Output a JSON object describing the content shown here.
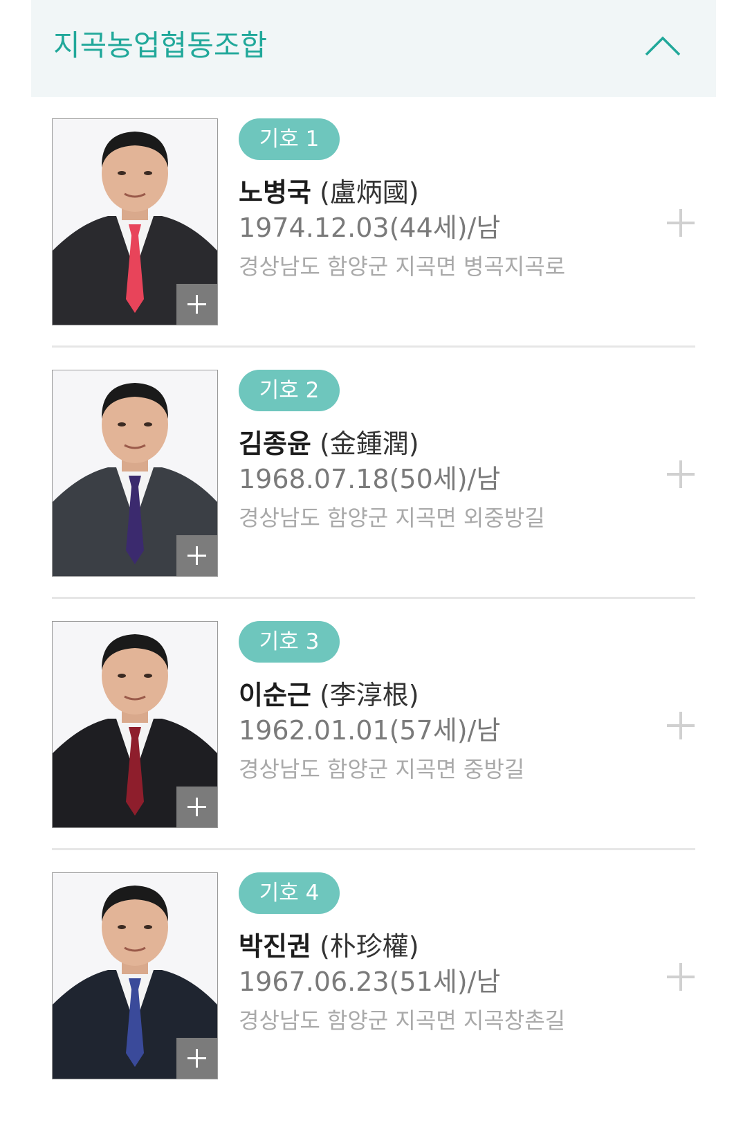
{
  "section": {
    "title": "지곡농업협동조합",
    "collapse_icon": "chevron-up-icon",
    "accent_color": "#21a89a"
  },
  "candidates": [
    {
      "number_label": "기호 1",
      "name": "노병국",
      "hanja": "(盧炳國)",
      "birth": "1974.12.03(44세)/남",
      "address": "경상남도 함양군 지곡면 병곡지곡로",
      "tie_color": "#e8445a",
      "suit_color": "#2a2a2e"
    },
    {
      "number_label": "기호 2",
      "name": "김종윤",
      "hanja": "(金鍾潤)",
      "birth": "1968.07.18(50세)/남",
      "address": "경상남도 함양군 지곡면 외중방길",
      "tie_color": "#3b2a6e",
      "suit_color": "#3b3f45"
    },
    {
      "number_label": "기호 3",
      "name": "이순근",
      "hanja": "(李淳根)",
      "birth": "1962.01.01(57세)/남",
      "address": "경상남도 함양군 지곡면 중방길",
      "tie_color": "#8e1e2c",
      "suit_color": "#1e1e22"
    },
    {
      "number_label": "기호 4",
      "name": "박진권",
      "hanja": "(朴珍權)",
      "birth": "1967.06.23(51세)/남",
      "address": "경상남도 함양군 지곡면 지곡창촌길",
      "tie_color": "#3a4a9a",
      "suit_color": "#1f2530"
    }
  ],
  "badge_color": "#6ec6bd"
}
